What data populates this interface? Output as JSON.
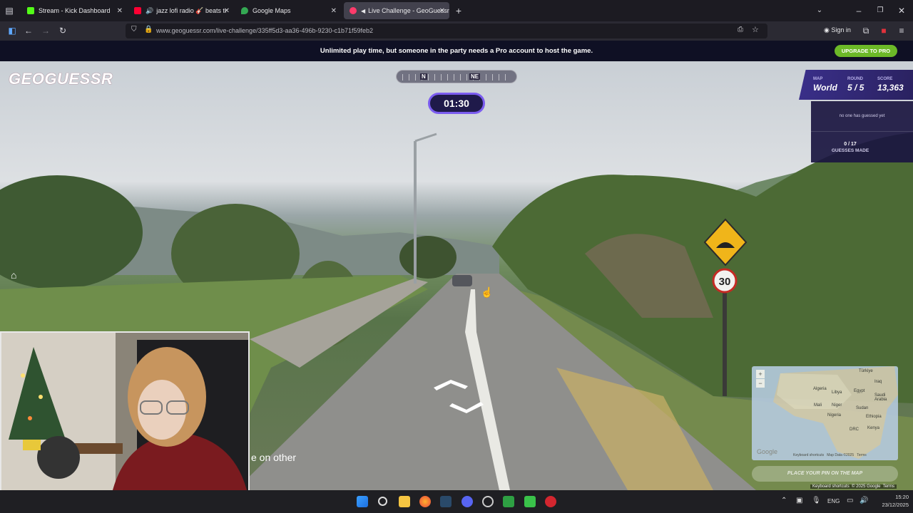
{
  "browser": {
    "tabs": [
      {
        "label": "Stream - Kick Dashboard",
        "favicon_color": "#53fc18"
      },
      {
        "label": "jazz lofi radio 🎸 beats to c",
        "favicon_color": "#ff0033"
      },
      {
        "label": "Google Maps",
        "favicon_color": "#34a853"
      },
      {
        "label": "Live Challenge - GeoGuessr",
        "favicon_color": "#ff3b6b"
      }
    ],
    "url": "www.geoguessr.com/live-challenge/335ff5d3-aa36-496b-9230-c1b71f59feb2",
    "sign_in": "Sign in"
  },
  "banner": {
    "message": "Unlimited play time, but someone in the party needs a Pro account to host the game.",
    "upgrade_label": "UPGRADE TO PRO"
  },
  "game": {
    "logo": "GEOGUESSR",
    "compass": {
      "marks": [
        "N",
        "NE"
      ]
    },
    "timer": "01:30",
    "status": {
      "map_label": "MAP",
      "map_value": "World",
      "round_label": "ROUND",
      "round_value": "5 / 5",
      "score_label": "SCORE",
      "score_value": "13,363"
    },
    "guess_status": "no one has guessed yet",
    "guesses_count": "0 / 17",
    "guesses_label": "GUESSES MADE",
    "speed_sign": "30",
    "minimap": {
      "labels": [
        "Türkiye",
        "Iraq",
        "Algeria",
        "Libya",
        "Egypt",
        "Saudi Arabia",
        "Mali",
        "Niger",
        "Sudan",
        "Nigeria",
        "Ethiopia",
        "DRC",
        "Kenya"
      ],
      "google": "Google",
      "footer": "Keyboard shortcuts   Map Data ©2025   Terms",
      "zoom_in": "+",
      "zoom_out": "−"
    },
    "place_pin": "PLACE YOUR PIN ON THE MAP",
    "bottom_google": "Keyboard shortcuts  © 2025 Google  Terms",
    "caption": "e on other"
  },
  "taskbar": {
    "lang": "ENG",
    "time": "15:20",
    "date": "23/12/2025"
  }
}
